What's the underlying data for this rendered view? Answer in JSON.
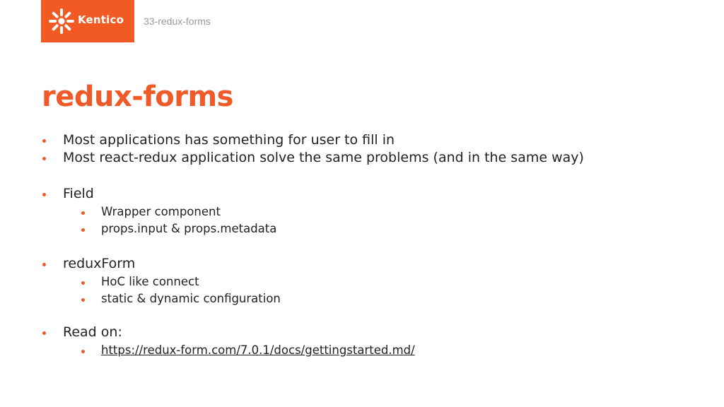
{
  "header": {
    "logo_text": "Kentico",
    "brand_color": "#f15a22",
    "slide_label": "33-redux-forms"
  },
  "slide": {
    "title": "redux-forms",
    "bullets": [
      {
        "level": 1,
        "text": "Most applications has something for user to fill in"
      },
      {
        "level": 1,
        "text": "Most react-redux application solve the same problems (and in the same way)"
      },
      {
        "level": 1,
        "text": "Field"
      },
      {
        "level": 2,
        "text": "Wrapper component"
      },
      {
        "level": 2,
        "text": "props.input & props.metadata"
      },
      {
        "level": 1,
        "text": "reduxForm"
      },
      {
        "level": 2,
        "text": "HoC like connect"
      },
      {
        "level": 2,
        "text": "static & dynamic configuration"
      },
      {
        "level": 1,
        "text": "Read on:"
      },
      {
        "level": 2,
        "text": "https://redux-form.com/7.0.1/docs/gettingstarted.md/",
        "is_link": true
      }
    ]
  }
}
